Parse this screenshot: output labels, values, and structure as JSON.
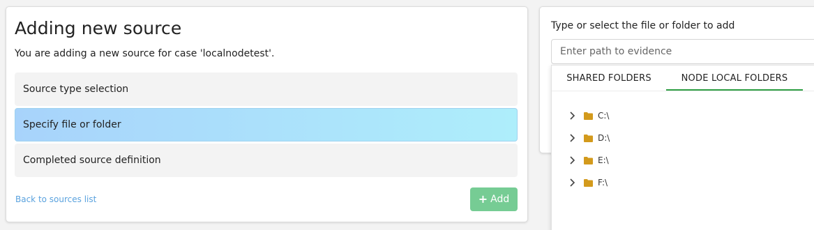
{
  "wizard": {
    "title": "Adding new source",
    "subtitle": "You are adding a new source for case 'localnodetest'.",
    "steps": [
      {
        "label": "Source type selection"
      },
      {
        "label": "Specify file or folder"
      },
      {
        "label": "Completed source definition"
      }
    ],
    "active_step": 1,
    "back_link": "Back to sources list",
    "add_button": "Add",
    "add_icon": "plus-icon"
  },
  "path_panel": {
    "label": "Type or select the file or folder to add",
    "placeholder": "Enter path to evidence"
  },
  "browser": {
    "tabs": [
      "SHARED FOLDERS",
      "NODE LOCAL FOLDERS"
    ],
    "active_tab": 1,
    "folders": [
      "C:\\",
      "D:\\",
      "E:\\",
      "F:\\"
    ],
    "folder_icon": "folder-icon",
    "expand_icon": "chevron-right-icon"
  },
  "colors": {
    "active_step_start": "#a8d3fb",
    "active_step_end": "#aeeefb",
    "add_button": "#76cc94",
    "link": "#5aa2de",
    "active_tab_underline": "#2e9e44",
    "folder": "#d39a1c"
  }
}
